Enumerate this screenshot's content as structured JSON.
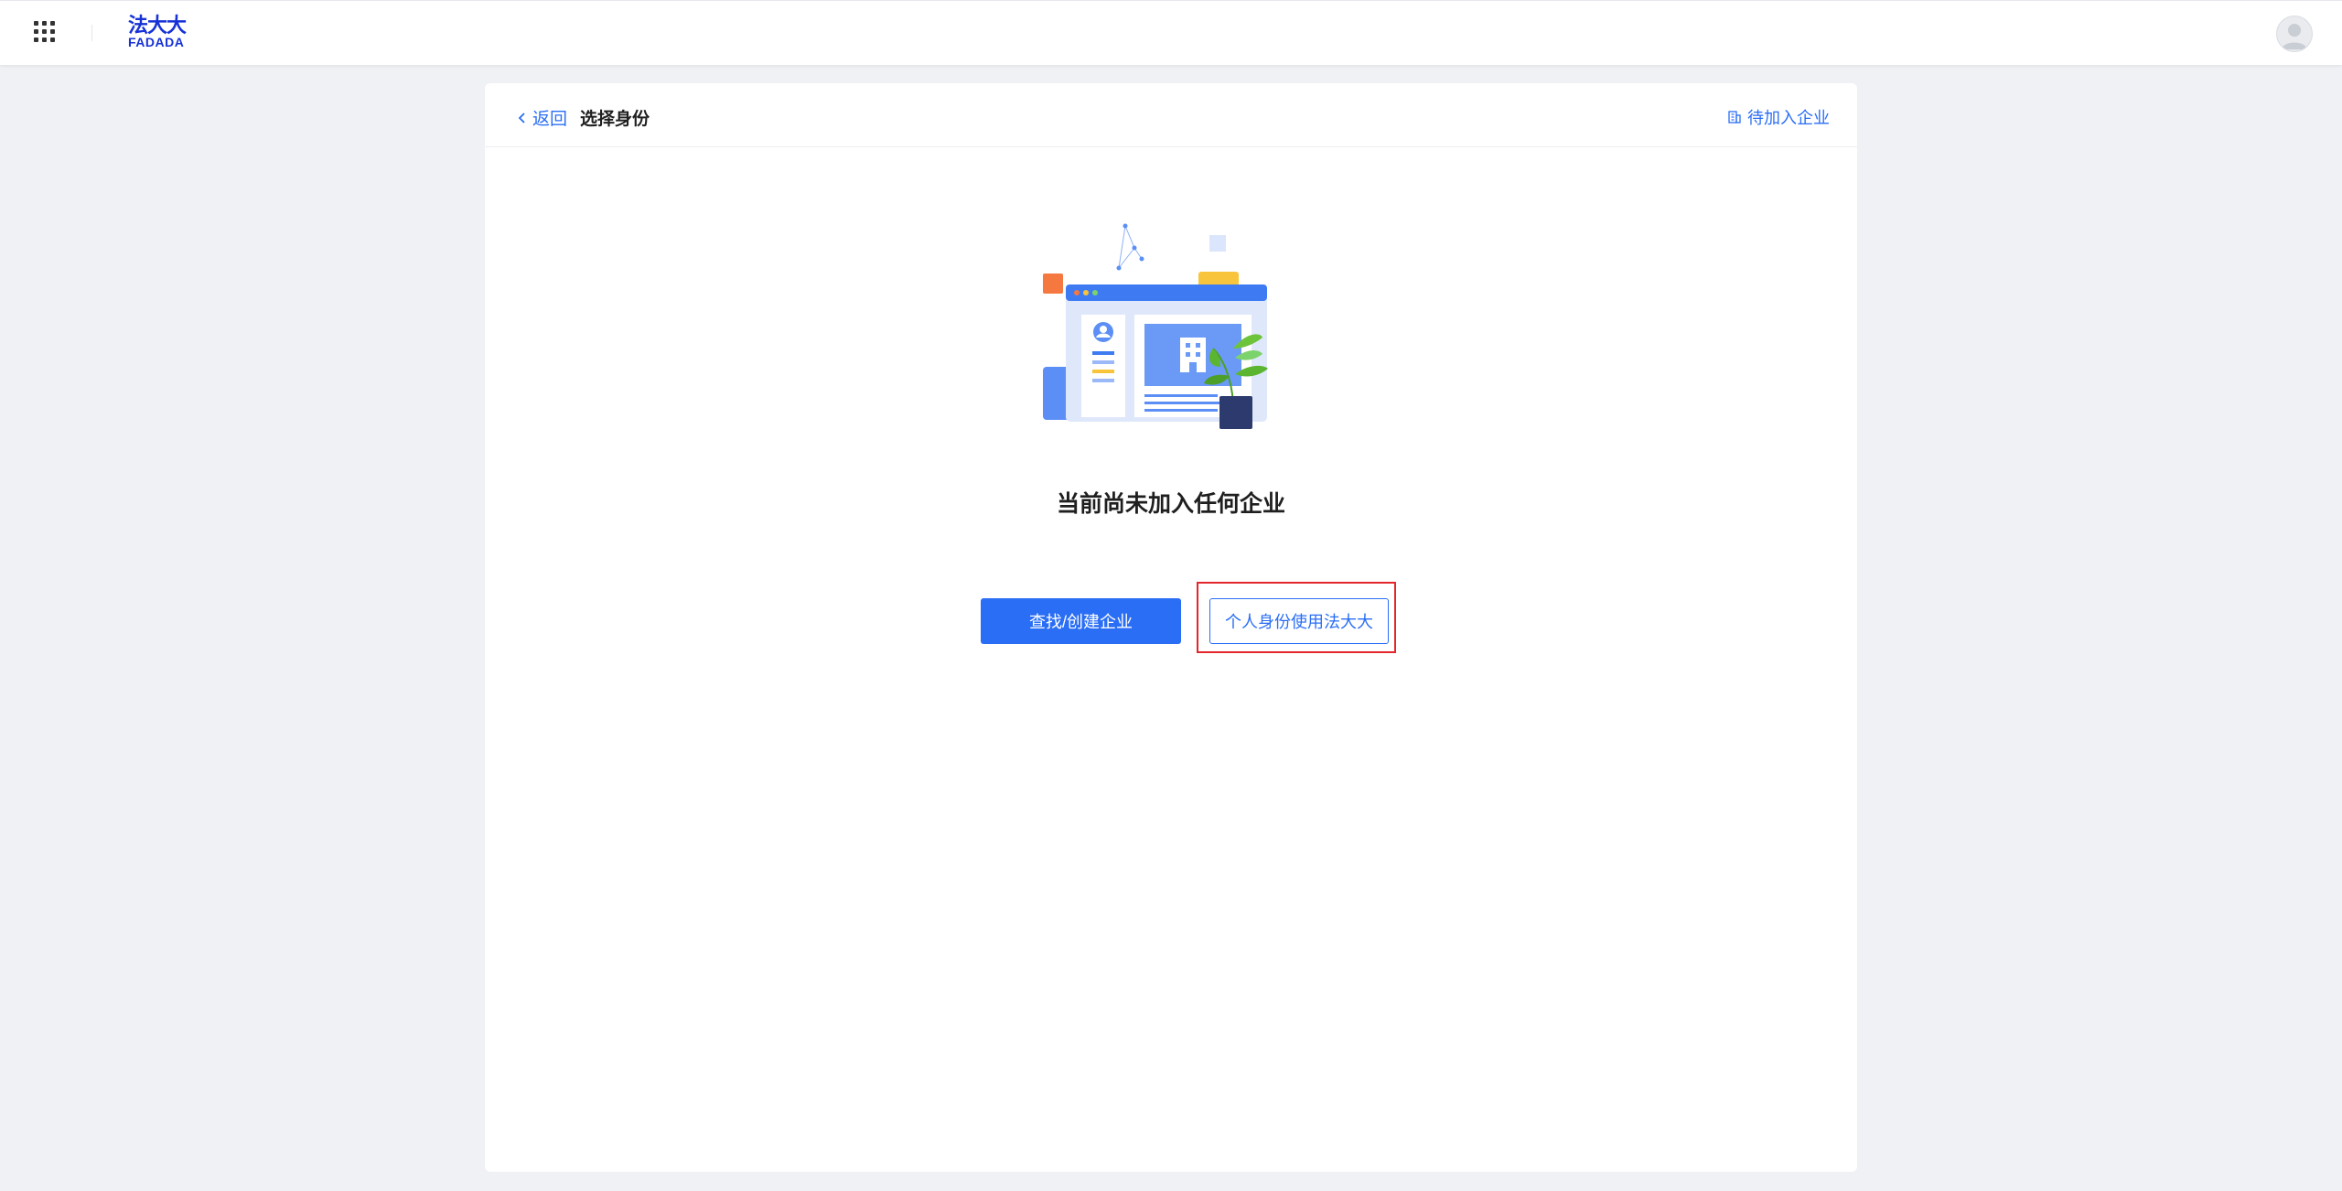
{
  "brand": {
    "name_cn": "法大大",
    "name_en": "FADADA",
    "color": "#1632d6"
  },
  "header": {
    "back_label": "返回",
    "title": "选择身份",
    "pending_label": "待加入企业"
  },
  "empty_state": {
    "message": "当前尚未加入任何企业"
  },
  "actions": {
    "primary_label": "查找/创建企业",
    "secondary_label": "个人身份使用法大大"
  },
  "colors": {
    "accent": "#2a6ef5",
    "highlight": "#e3262b",
    "background": "#f0f1f4"
  },
  "icons": [
    "apps-grid-icon",
    "user-avatar-icon",
    "chevron-left-icon",
    "building-icon"
  ]
}
